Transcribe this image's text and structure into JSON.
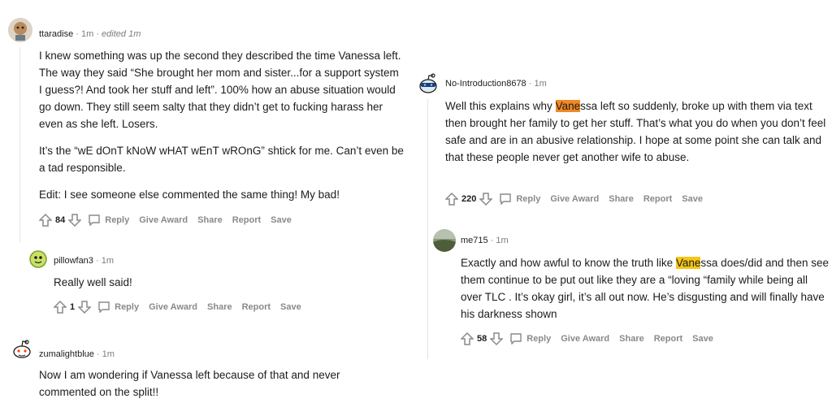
{
  "left": [
    {
      "user": "ttaradise",
      "meta": " · 1m · ",
      "edited": "edited 1m",
      "paragraphs": [
        "I knew something was up the second they described the time Vanessa left. The way they said “She brought her mom and sister...for a support system I guess?! And took her stuff and left”. 100% how an abuse situation would go down. They still seem salty that they didn’t get to fucking harass her even as she left. Losers.",
        "It’s the “wE dOnT kNoW wHAT wEnT wROnG” shtick for me. Can’t even be a tad responsible.",
        "Edit: I see someone else commented the same thing! My bad!"
      ],
      "votes": "84"
    },
    {
      "user": "pillowfan3",
      "meta": " · 1m",
      "paragraphs": [
        "Really well said!"
      ],
      "votes": "1"
    },
    {
      "user": "zumalightblue",
      "meta": " · 1m",
      "paragraphs": [
        "Now I am wondering if Vanessa left because of that and never commented on the split!!"
      ]
    }
  ],
  "right": [
    {
      "user": "No-Introduction8678",
      "meta": " · 1m",
      "hl": "Vane",
      "text_after": "ssa left so suddenly, broke up with them via text then brought her family to get her stuff. That’s what you do when you don’t feel safe and are in an abusive relationship. I hope at some point she can talk and that these people never get another wife to abuse.",
      "text_before": "Well this explains why ",
      "votes": "220"
    },
    {
      "user": "me715",
      "meta": " · 1m",
      "text_before": "Exactly and how awful to know the truth like ",
      "hl": "Vane",
      "text_after": "ssa does/did and then see them continue to be put out like they are a “loving “family while being all over TLC . It’s okay girl, it’s all out now. He’s disgusting and will finally have his darkness shown",
      "votes": "58"
    }
  ],
  "actions": {
    "reply": "Reply",
    "give_award": "Give Award",
    "share": "Share",
    "report": "Report",
    "save": "Save"
  },
  "colors": {
    "highlight_yellow": "#f5c518",
    "highlight_orange": "#f08a24",
    "meta_gray": "#7c7c7c"
  }
}
